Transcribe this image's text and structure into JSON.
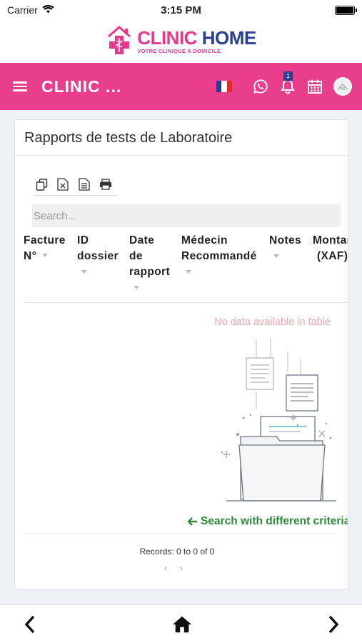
{
  "status_bar": {
    "carrier": "Carrier",
    "time": "3:15 PM",
    "icons": [
      "wifi-icon",
      "battery-icon"
    ]
  },
  "brand": {
    "name_part1": "CLINIC",
    "name_part2": "HOME",
    "tagline": "VOTRE CLINIQUE A DOMICILE",
    "colors": {
      "pink": "#e8388e",
      "navy": "#2a3f8f"
    }
  },
  "app_bar": {
    "title": "CLINIC ...",
    "background": "#e83e8c",
    "notification_count": "1",
    "icons": [
      "menu-icon",
      "french-flag-icon",
      "whatsapp-icon",
      "bell-icon",
      "calendar-icon",
      "avatar"
    ]
  },
  "card": {
    "title": "Rapports de tests de Laboratoire",
    "toolbar": [
      "copy-icon",
      "excel-icon",
      "csv-icon",
      "print-icon"
    ],
    "search_placeholder": "Search...",
    "columns": [
      {
        "line1": "Facture",
        "line2": "N°"
      },
      {
        "line1": "ID",
        "line2": "dossier"
      },
      {
        "line1": "Date",
        "line2": "de",
        "line3": "rapport"
      },
      {
        "line1": "Médecin",
        "line2": "Recommandé"
      },
      {
        "line1": "Notes"
      },
      {
        "line1": "Montant",
        "line2": "(XAF)"
      }
    ],
    "no_data": "No data available in table",
    "retry_label": "Search with different criteria",
    "records": "Records: 0 to 0 of 0",
    "pager": {
      "prev": "‹",
      "next": "›"
    }
  },
  "bottom_nav": [
    "back-icon",
    "home-icon",
    "forward-icon"
  ]
}
